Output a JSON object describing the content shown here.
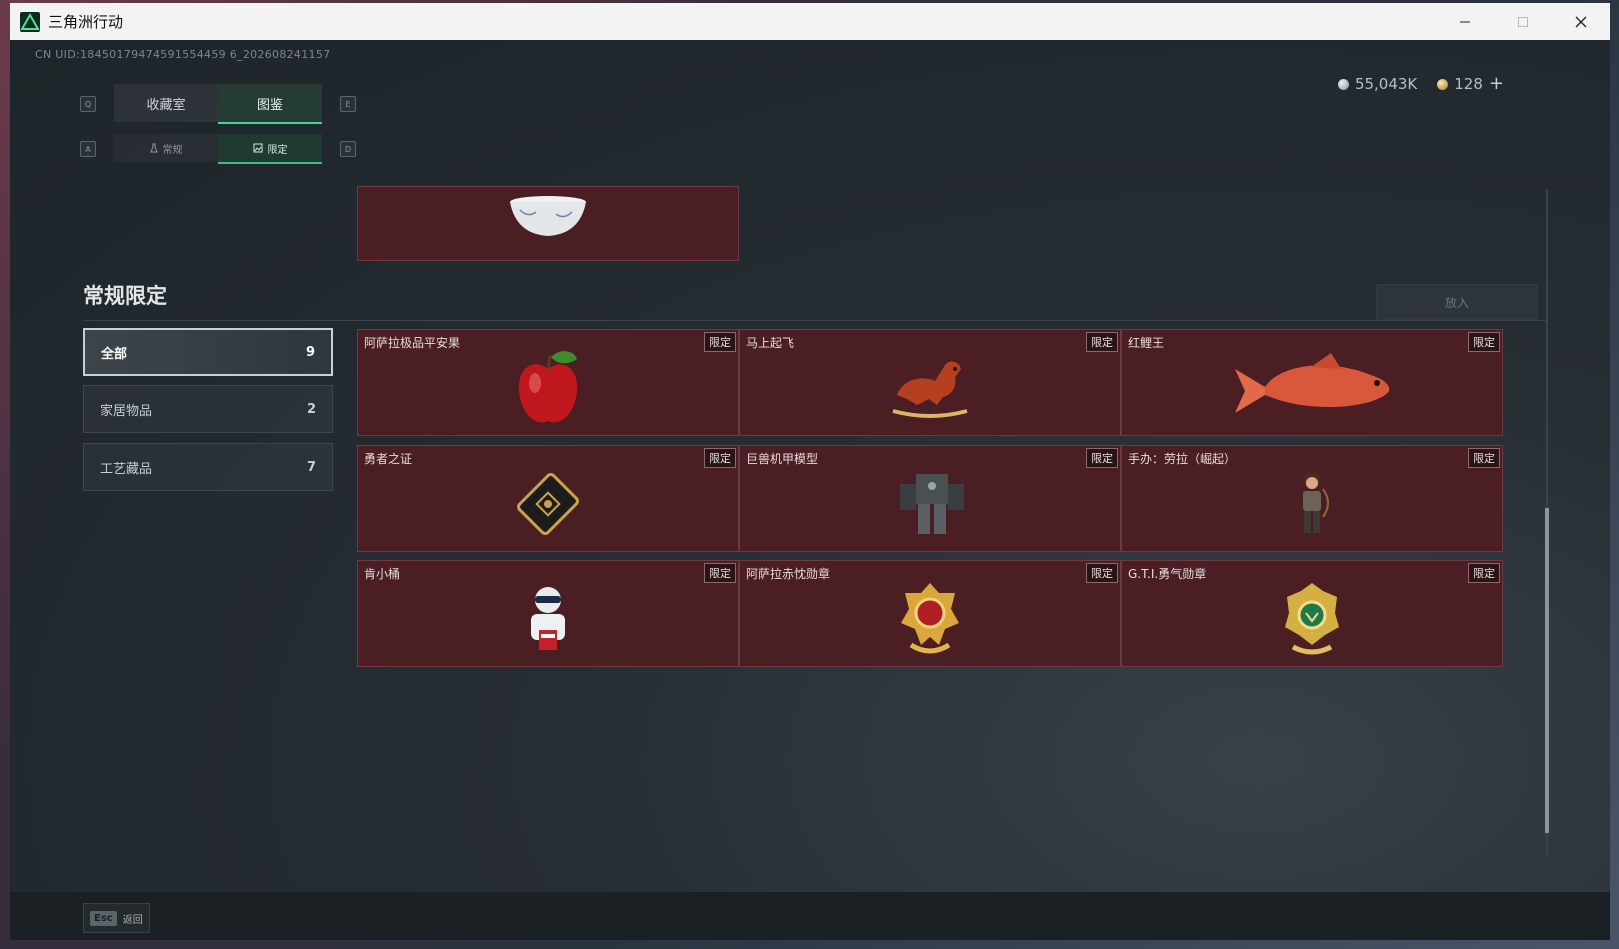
{
  "window": {
    "title": "三角洲行动"
  },
  "uid": "CN UID:18450179474591554459 6_202608241157",
  "currency": {
    "silver": "55,043K",
    "gold": "128",
    "add": "+"
  },
  "keys": {
    "tab_prev": "Q",
    "tab_next": "E",
    "sub_prev": "A",
    "sub_next": "D"
  },
  "tabs": [
    {
      "label": "收藏室"
    },
    {
      "label": "图鉴"
    }
  ],
  "subtabs": [
    {
      "label": "常规"
    },
    {
      "label": "限定"
    }
  ],
  "section": {
    "title": "常规限定",
    "release_button": "放入"
  },
  "categories": [
    {
      "label": "全部",
      "count": "9"
    },
    {
      "label": "家居物品",
      "count": "2"
    },
    {
      "label": "工艺藏品",
      "count": "7"
    }
  ],
  "items": [
    {
      "name": "阿萨拉极品平安果",
      "badge": "限定",
      "icon": "apple-icon"
    },
    {
      "name": "马上起飞",
      "badge": "限定",
      "icon": "horse-icon"
    },
    {
      "name": "红鲤王",
      "badge": "限定",
      "icon": "carp-icon"
    },
    {
      "name": "勇者之证",
      "badge": "限定",
      "icon": "card-icon"
    },
    {
      "name": "巨兽机甲模型",
      "badge": "限定",
      "icon": "mecha-icon"
    },
    {
      "name": "手办：劳拉（崛起）",
      "badge": "限定",
      "icon": "figure-icon"
    },
    {
      "name": "肯小桶",
      "badge": "限定",
      "icon": "colonel-icon"
    },
    {
      "name": "阿萨拉赤忱勋章",
      "badge": "限定",
      "icon": "red-medal-icon"
    },
    {
      "name": "G.T.I.勇气勋章",
      "badge": "限定",
      "icon": "green-medal-icon"
    }
  ],
  "footer": {
    "esc_key": "Esc",
    "back_label": "返回"
  },
  "colors": {
    "accent": "#4fd28a",
    "card_bg": "#4a1e23"
  }
}
